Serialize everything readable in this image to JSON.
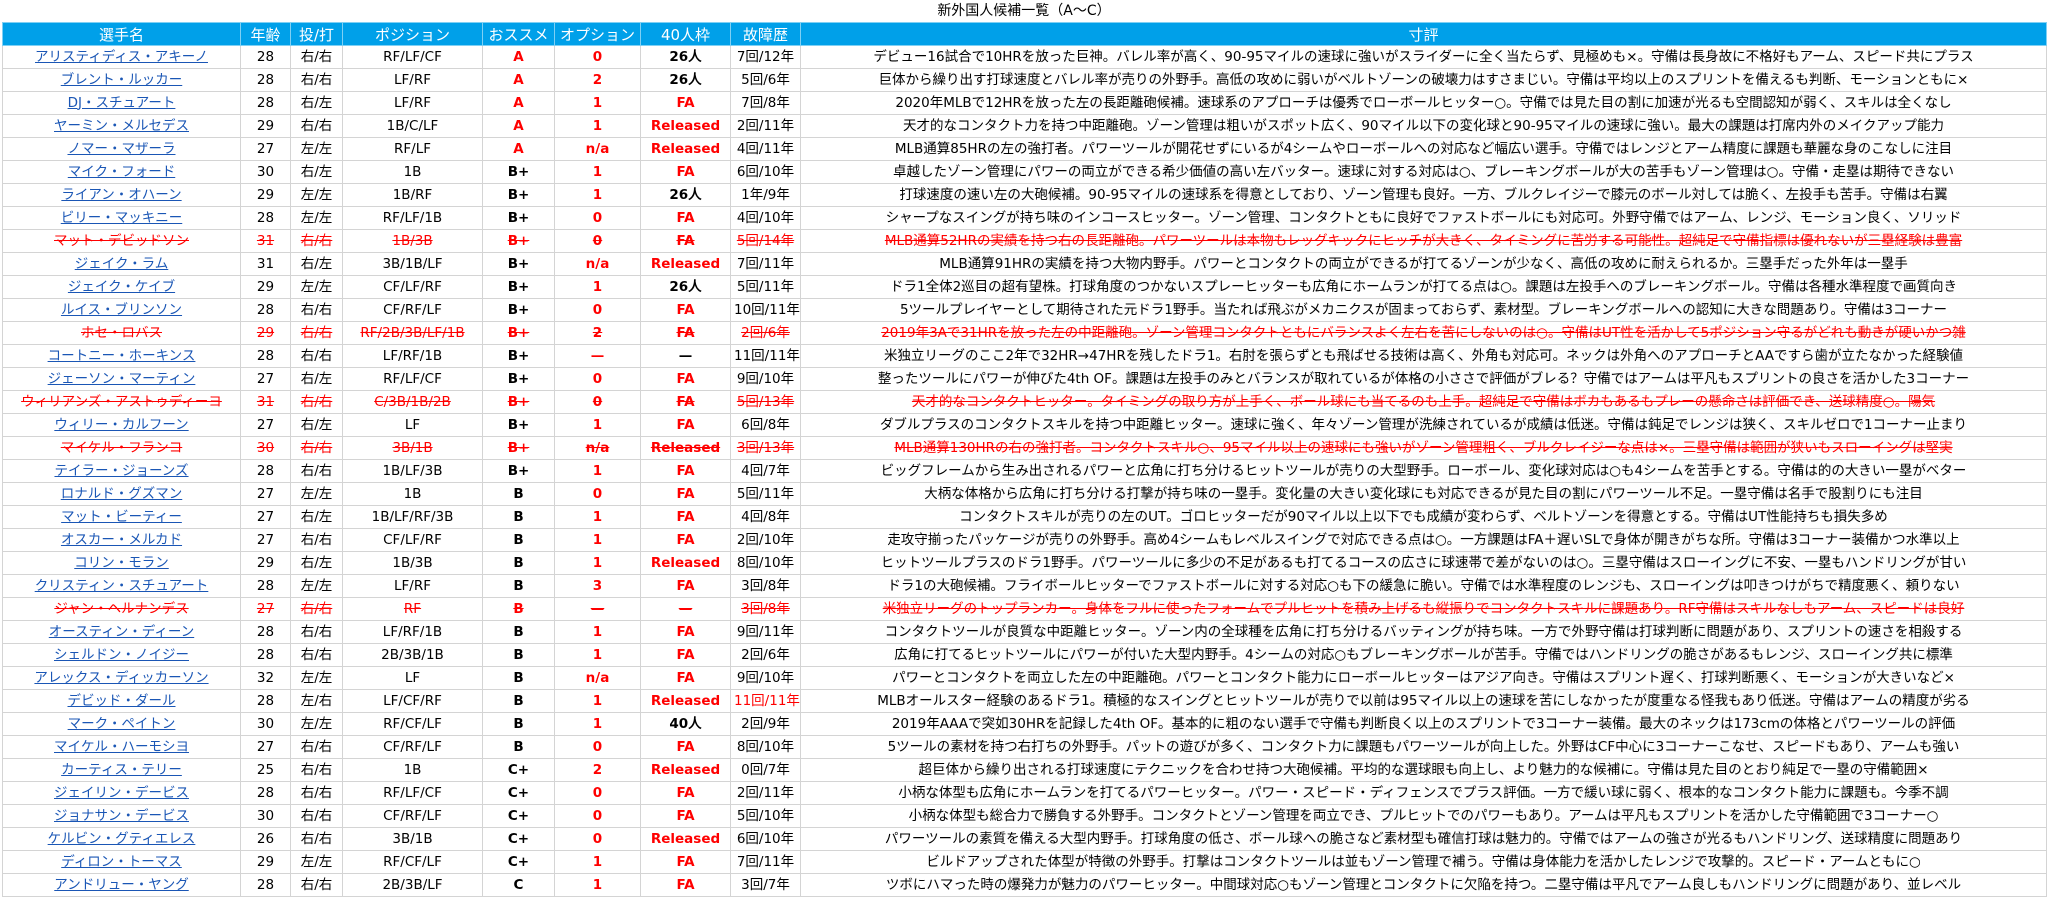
{
  "title": "新外国人候補一覧（A〜C）",
  "headers": [
    "選手名",
    "年齢",
    "投/打",
    "ポジション",
    "おススメ",
    "オプション",
    "40人枠",
    "故障歴",
    "寸評"
  ],
  "rows": [
    {
      "name": "アリスティディス・アキーノ",
      "age": "28",
      "bt": "右/右",
      "pos": "RF/LF/CF",
      "rank": "A",
      "opt": "0",
      "roster": "26人",
      "inj": "7回/12年",
      "comment": "デビュー16試合で10HRを放った巨神。バレル率が高く、90-95マイルの速球に強いがスライダーに全く当たらず、見極めも×。守備は長身故に不格好もアーム、スピード共にプラス",
      "struck": false
    },
    {
      "name": "ブレント・ルッカー",
      "age": "28",
      "bt": "右/右",
      "pos": "LF/RF",
      "rank": "A",
      "opt": "2",
      "roster": "26人",
      "inj": "5回/6年",
      "comment": "巨体から繰り出す打球速度とバレル率が売りの外野手。高低の攻めに弱いがベルトゾーンの破壊力はすさまじい。守備は平均以上のスプリントを備えるも判断、モーションともに×",
      "struck": false
    },
    {
      "name": "DJ・スチュアート",
      "age": "28",
      "bt": "右/左",
      "pos": "LF/RF",
      "rank": "A",
      "opt": "1",
      "roster": "FA",
      "inj": "7回/8年",
      "comment": "2020年MLBで12HRを放った左の長距離砲候補。速球系のアプローチは優秀でローボールヒッター○。守備では見た目の割に加速が光るも空間認知が弱く、スキルは全くなし",
      "struck": false
    },
    {
      "name": "ヤーミン・メルセデス",
      "age": "29",
      "bt": "右/右",
      "pos": "1B/C/LF",
      "rank": "A",
      "opt": "1",
      "roster": "Released",
      "inj": "2回/11年",
      "comment": "天才的なコンタクト力を持つ中距離砲。ゾーン管理は粗いがスポット広く、90マイル以下の変化球と90-95マイルの速球に強い。最大の課題は打席内外のメイクアップ能力",
      "struck": false
    },
    {
      "name": "ノマー・マザーラ",
      "age": "27",
      "bt": "左/左",
      "pos": "RF/LF",
      "rank": "A",
      "opt": "n/a",
      "roster": "Released",
      "inj": "4回/11年",
      "comment": "MLB通算85HRの左の強打者。パワーツールが開花せずにいるが4シームやローボールへの対応など幅広い選手。守備ではレンジとアーム精度に課題も華麗な身のこなしに注目",
      "struck": false
    },
    {
      "name": "マイク・フォード",
      "age": "30",
      "bt": "右/左",
      "pos": "1B",
      "rank": "B+",
      "opt": "1",
      "roster": "FA",
      "inj": "6回/10年",
      "comment": "卓越したゾーン管理にパワーの両立ができる希少価値の高い左バッター。速球に対する対応は○、ブレーキングボールが大の苦手もゾーン管理は○。守備・走塁は期待できない",
      "struck": false
    },
    {
      "name": "ライアン・オハーン",
      "age": "29",
      "bt": "左/左",
      "pos": "1B/RF",
      "rank": "B+",
      "opt": "1",
      "roster": "26人",
      "inj": "1年/9年",
      "comment": "打球速度の速い左の大砲候補。90-95マイルの速球系を得意としており、ゾーン管理も良好。一方、ブルクレイジーで膝元のボール対しては脆く、左投手も苦手。守備は右翼",
      "struck": false
    },
    {
      "name": "ビリー・マッキニー",
      "age": "28",
      "bt": "左/左",
      "pos": "RF/LF/1B",
      "rank": "B+",
      "opt": "0",
      "roster": "FA",
      "inj": "4回/10年",
      "comment": "シャープなスイングが持ち味のインコースヒッター。ゾーン管理、コンタクトともに良好でファストボールにも対応可。外野守備ではアーム、レンジ、モーション良く、ソリッド",
      "struck": false
    },
    {
      "name": "マット・デビッドソン",
      "age": "31",
      "bt": "右/右",
      "pos": "1B/3B",
      "rank": "B+",
      "opt": "0",
      "roster": "FA",
      "inj": "5回/14年",
      "comment": "MLB通算52HRの実績を持つ右の長距離砲。パワーツールは本物もレッグキックにヒッチが大きく、タイミングに苦労する可能性。超純足で守備指標は優れないが三塁経験は豊富",
      "struck": true
    },
    {
      "name": "ジェイク・ラム",
      "age": "31",
      "bt": "右/左",
      "pos": "3B/1B/LF",
      "rank": "B+",
      "opt": "n/a",
      "roster": "Released",
      "inj": "7回/11年",
      "comment": "MLB通算91HRの実績を持つ大物内野手。パワーとコンタクトの両立ができるが打てるゾーンが少なく、高低の攻めに耐えられるか。三塁手だった外年は一塁手",
      "struck": false
    },
    {
      "name": "ジェイク・ケイブ",
      "age": "29",
      "bt": "左/左",
      "pos": "CF/LF/RF",
      "rank": "B+",
      "opt": "1",
      "roster": "26人",
      "inj": "5回/11年",
      "comment": "ドラ1全体2巡目の超有望株。打球角度のつかないスプレーヒッターも広角にホームランが打てる点は○。課題は左投手へのブレーキングボール。守備は各種水準程度で画質向き",
      "struck": false
    },
    {
      "name": "ルイス・ブリンソン",
      "age": "28",
      "bt": "右/右",
      "pos": "CF/RF/LF",
      "rank": "B+",
      "opt": "0",
      "roster": "FA",
      "inj": "10回/11年",
      "comment": "5ツールプレイヤーとして期待された元ドラ1野手。当たれば飛ぶがメカニクスが固まっておらず、素材型。ブレーキングボールへの認知に大きな問題あり。守備は3コーナー",
      "struck": false
    },
    {
      "name": "ホセ・ロバス",
      "age": "29",
      "bt": "右/右",
      "pos": "RF/2B/3B/LF/1B",
      "rank": "B+",
      "opt": "2",
      "roster": "FA",
      "inj": "2回/6年",
      "comment": "2019年3Aで31HRを放った左の中距離砲。ゾーン管理コンタクトともにバランスよく左右を苦にしないのは○。守備はUT性を活かして5ポジション守るがどれも動きが硬いかつ雑",
      "struck": true
    },
    {
      "name": "コートニー・ホーキンス",
      "age": "28",
      "bt": "右/右",
      "pos": "LF/RF/1B",
      "rank": "B+",
      "opt": "—",
      "roster": "—",
      "inj": "11回/11年",
      "comment": "米独立リーグのここ2年で32HR→47HRを残したドラ1。右肘を張らずとも飛ばせる技術は高く、外角も対応可。ネックは外角へのアプローチとAAですら歯が立たなかった経験値",
      "struck": false
    },
    {
      "name": "ジェーソン・マーティン",
      "age": "27",
      "bt": "右/左",
      "pos": "RF/LF/CF",
      "rank": "B+",
      "opt": "0",
      "roster": "FA",
      "inj": "9回/10年",
      "comment": "整ったツールにパワーが伸びた4th OF。課題は左投手のみとバランスが取れているが体格の小ささで評価がブレる？守備ではアームは平凡もスプリントの良さを活かした3コーナー",
      "struck": false
    },
    {
      "name": "ウィリアンズ・アストゥディーヨ",
      "age": "31",
      "bt": "右/右",
      "pos": "C/3B/1B/2B",
      "rank": "B+",
      "opt": "0",
      "roster": "FA",
      "inj": "5回/13年",
      "comment": "天才的なコンタクトヒッター。タイミングの取り方が上手く、ボール球にも当てるのも上手。超純足で守備はボカもあるもプレーの懸命さは評価でき、送球精度○。陽気",
      "struck": true
    },
    {
      "name": "ウィリー・カルフーン",
      "age": "27",
      "bt": "右/左",
      "pos": "LF",
      "rank": "B+",
      "opt": "1",
      "roster": "FA",
      "inj": "6回/8年",
      "comment": "ダブルプラスのコンタクトスキルを持つ中距離ヒッター。速球に強く、年々ゾーン管理が洗練されているが成績は低迷。守備は鈍足でレンジは狭く、スキルゼロで1コーナー止まり",
      "struck": false
    },
    {
      "name": "マイケル・フランコ",
      "age": "30",
      "bt": "右/右",
      "pos": "3B/1B",
      "rank": "B+",
      "opt": "n/a",
      "roster": "Released",
      "inj": "3回/13年",
      "comment": "MLB通算130HRの右の強打者。コンタクトスキル○、95マイル以上の速球にも強いがゾーン管理粗く、ブルクレイジーな点は×。三塁守備は範囲が狭いもスローイングは堅実",
      "struck": true
    },
    {
      "name": "テイラー・ジョーンズ",
      "age": "28",
      "bt": "右/右",
      "pos": "1B/LF/3B",
      "rank": "B+",
      "opt": "1",
      "roster": "FA",
      "inj": "4回/7年",
      "comment": "ビッグフレームから生み出されるパワーと広角に打ち分けるヒットツールが売りの大型野手。ローボール、変化球対応は○も4シームを苦手とする。守備は的の大きい一塁がベター",
      "struck": false
    },
    {
      "name": "ロナルド・グズマン",
      "age": "27",
      "bt": "左/左",
      "pos": "1B",
      "rank": "B",
      "opt": "0",
      "roster": "FA",
      "inj": "5回/11年",
      "comment": "大柄な体格から広角に打ち分ける打撃が持ち味の一塁手。変化量の大きい変化球にも対応できるが見た目の割にパワーツール不足。一塁守備は名手で股割りにも注目",
      "struck": false
    },
    {
      "name": "マット・ビーティー",
      "age": "27",
      "bt": "右/左",
      "pos": "1B/LF/RF/3B",
      "rank": "B",
      "opt": "1",
      "roster": "FA",
      "inj": "4回/8年",
      "comment": "コンタクトスキルが売りの左のUT。ゴロヒッターだが90マイル以上以下でも成績が変わらず、ベルトゾーンを得意とする。守備はUT性能持ちも損失多め",
      "struck": false
    },
    {
      "name": "オスカー・メルカド",
      "age": "27",
      "bt": "右/右",
      "pos": "CF/LF/RF",
      "rank": "B",
      "opt": "1",
      "roster": "FA",
      "inj": "2回/10年",
      "comment": "走攻守揃ったパッケージが売りの外野手。高め4シームもレベルスイングで対応できる点は○。一方課題はFA＋遅いSLで身体が開きがちな所。守備は3コーナー装備かつ水準以上",
      "struck": false
    },
    {
      "name": "コリン・モラン",
      "age": "29",
      "bt": "右/左",
      "pos": "1B/3B",
      "rank": "B",
      "opt": "1",
      "roster": "Released",
      "inj": "8回/10年",
      "comment": "ヒットツールプラスのドラ1野手。パワーツールに多少の不足があるも打てるコースの広さに球速帯で差がないのは○。三塁守備はスローイングに不安、一塁もハンドリングが甘い",
      "struck": false
    },
    {
      "name": "クリスティン・スチュアート",
      "age": "28",
      "bt": "左/左",
      "pos": "LF/RF",
      "rank": "B",
      "opt": "3",
      "roster": "FA",
      "inj": "3回/8年",
      "comment": "ドラ1の大砲候補。フライボールヒッターでファストボールに対する対応○も下の緩急に脆い。守備では水準程度のレンジも、スローイングは叩きつけがちで精度悪く、頼りない",
      "struck": false
    },
    {
      "name": "ジャン・ヘルナンデス",
      "age": "27",
      "bt": "右/右",
      "pos": "RF",
      "rank": "B",
      "opt": "—",
      "roster": "—",
      "inj": "3回/8年",
      "comment": "米独立リーグのトップランカー。身体をフルに使ったフォームでプルヒットを積み上げるも縦振りでコンタクトスキルに課題あり。RF守備はスキルなしもアーム、スピードは良好",
      "struck": true
    },
    {
      "name": "オースティン・ディーン",
      "age": "28",
      "bt": "右/右",
      "pos": "LF/RF/1B",
      "rank": "B",
      "opt": "1",
      "roster": "FA",
      "inj": "9回/11年",
      "comment": "コンタクトツールが良質な中距離ヒッター。ゾーン内の全球種を広角に打ち分けるバッティングが持ち味。一方で外野守備は打球判断に問題があり、スプリントの速さを相殺する",
      "struck": false
    },
    {
      "name": "シェルドン・ノイジー",
      "age": "28",
      "bt": "右/右",
      "pos": "2B/3B/1B",
      "rank": "B",
      "opt": "1",
      "roster": "FA",
      "inj": "2回/6年",
      "comment": "広角に打てるヒットツールにパワーが付いた大型内野手。4シームの対応○もブレーキングボールが苦手。守備ではハンドリングの脆さがあるもレンジ、スローイング共に標準",
      "struck": false
    },
    {
      "name": "アレックス・ディッカーソン",
      "age": "32",
      "bt": "左/左",
      "pos": "LF",
      "rank": "B",
      "opt": "n/a",
      "roster": "FA",
      "inj": "9回/10年",
      "comment": "パワーとコンタクトを両立した左の中距離砲。パワーとコンタクト能力にローボールヒッターはアジア向き。守備はスプリント遅く、打球判断悪く、モーションが大きいなど×",
      "struck": false
    },
    {
      "name": "デビッド・ダール",
      "age": "28",
      "bt": "左/右",
      "pos": "LF/CF/RF",
      "rank": "B",
      "opt": "1",
      "roster": "Released",
      "inj": "11回/11年",
      "comment": "MLBオールスター経験のあるドラ1。積極的なスイングとヒットツールが売りで以前は95マイル以上の速球を苦にしなかったが度重なる怪我もあり低迷。守備はアームの精度が劣る",
      "struck": false
    },
    {
      "name": "マーク・ペイトン",
      "age": "30",
      "bt": "左/左",
      "pos": "RF/CF/LF",
      "rank": "B",
      "opt": "1",
      "roster": "40人",
      "inj": "2回/9年",
      "comment": "2019年AAAで突如30HRを記録した4th OF。基本的に粗のない選手で守備も判断良く以上のスプリントで3コーナー装備。最大のネックは173cmの体格とパワーツールの評価",
      "struck": false
    },
    {
      "name": "マイケル・ハーモシヨ",
      "age": "27",
      "bt": "右/右",
      "pos": "CF/RF/LF",
      "rank": "B",
      "opt": "0",
      "roster": "FA",
      "inj": "8回/10年",
      "comment": "5ツールの素材を持つ右打ちの外野手。パットの遊びが多く、コンタクト力に課題もパワーツールが向上した。外野はCF中心に3コーナーこなせ、スピードもあり、アームも強い",
      "struck": false
    },
    {
      "name": "カーティス・テリー",
      "age": "25",
      "bt": "右/右",
      "pos": "1B",
      "rank": "C+",
      "opt": "2",
      "roster": "Released",
      "inj": "0回/7年",
      "comment": "超巨体から繰り出される打球速度にテクニックを合わせ持つ大砲候補。平均的な選球眼も向上し、より魅力的な候補に。守備は見た目のとおり純足で一塁の守備範囲×",
      "struck": false
    },
    {
      "name": "ジェイリン・デービス",
      "age": "28",
      "bt": "右/右",
      "pos": "RF/LF/CF",
      "rank": "C+",
      "opt": "0",
      "roster": "FA",
      "inj": "2回/11年",
      "comment": "小柄な体型も広角にホームランを打てるパワーヒッター。パワー・スピード・ディフェンスでプラス評価。一方で緩い球に弱く、根本的なコンタクト能力に課題も。今季不調",
      "struck": false
    },
    {
      "name": "ジョナサン・デービス",
      "age": "30",
      "bt": "右/右",
      "pos": "CF/RF/LF",
      "rank": "C+",
      "opt": "0",
      "roster": "FA",
      "inj": "5回/10年",
      "comment": "小柄な体型も総合力で勝負する外野手。コンタクトとゾーン管理を両立でき、プルヒットでのパワーもあり。アームは平凡もスプリントを活かした守備範囲で3コーナー○",
      "struck": false
    },
    {
      "name": "ケルビン・グティエレス",
      "age": "26",
      "bt": "右/右",
      "pos": "3B/1B",
      "rank": "C+",
      "opt": "0",
      "roster": "Released",
      "inj": "6回/10年",
      "comment": "パワーツールの素質を備える大型内野手。打球角度の低さ、ボール球への脆さなど素材型も確信打球は魅力的。守備ではアームの強さが光るもハンドリング、送球精度に問題あり",
      "struck": false
    },
    {
      "name": "ディロン・トーマス",
      "age": "29",
      "bt": "左/左",
      "pos": "RF/CF/LF",
      "rank": "C+",
      "opt": "1",
      "roster": "FA",
      "inj": "7回/11年",
      "comment": "ビルドアップされた体型が特徴の外野手。打撃はコンタクトツールは並もゾーン管理で補う。守備は身体能力を活かしたレンジで攻撃的。スピード・アームともに○",
      "struck": false
    },
    {
      "name": "アンドリュー・ヤング",
      "age": "28",
      "bt": "右/右",
      "pos": "2B/3B/LF",
      "rank": "C",
      "opt": "1",
      "roster": "FA",
      "inj": "3回/7年",
      "comment": "ツボにハマった時の爆発力が魅力のパワーヒッター。中間球対応○もゾーン管理とコンタクトに欠陥を持つ。二塁守備は平凡でアーム良しもハンドリングに問題があり、並レベル",
      "struck": false
    }
  ]
}
